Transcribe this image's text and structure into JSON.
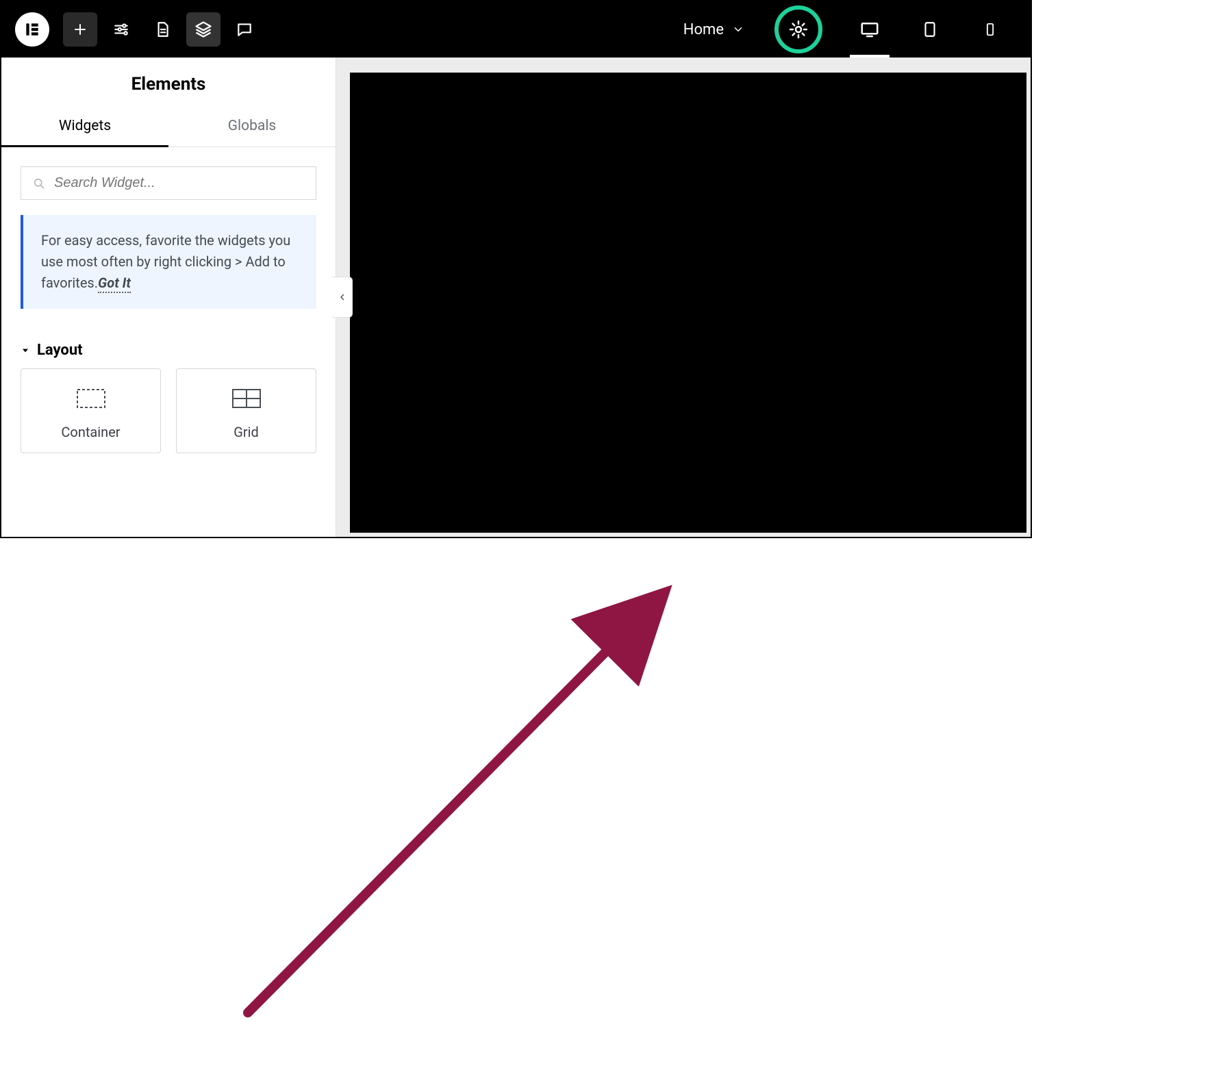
{
  "topbar": {
    "page_label": "Home"
  },
  "sidebar": {
    "title": "Elements",
    "tabs": {
      "widgets": "Widgets",
      "globals": "Globals"
    },
    "search": {
      "placeholder": "Search Widget..."
    },
    "info": {
      "text": "For easy access, favorite the widgets you use most often by right clicking > Add to favorites.",
      "gotit": "Got It"
    },
    "section_layout": "Layout",
    "widgets": {
      "container": "Container",
      "grid": "Grid"
    }
  },
  "annotation": {
    "highlight_color": "#1dd19a",
    "arrow_color": "#8f1643"
  }
}
